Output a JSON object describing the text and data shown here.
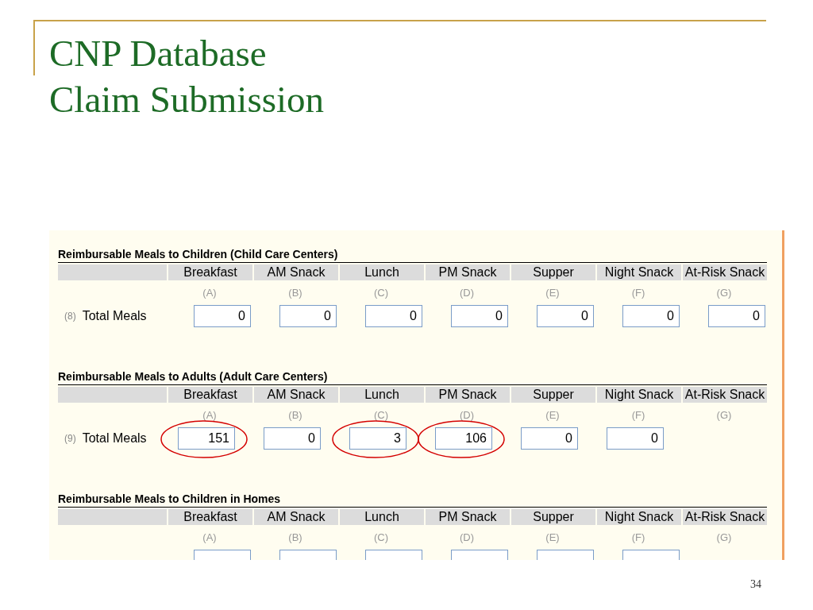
{
  "slide": {
    "title_lines": [
      "CNP Database",
      "Claim Submission"
    ],
    "page_number": "34"
  },
  "sections": [
    {
      "heading": "Reimbursable Meals to Children (Child Care Centers)",
      "columns": [
        "Breakfast",
        "AM Snack",
        "Lunch",
        "PM Snack",
        "Supper",
        "Night Snack",
        "At-Risk Snack"
      ],
      "letters": [
        "(A)",
        "(B)",
        "(C)",
        "(D)",
        "(E)",
        "(F)",
        "(G)"
      ],
      "row": {
        "number": "(8)",
        "label": "Total Meals",
        "fields": [
          {
            "value": "0",
            "circled": false
          },
          {
            "value": "0",
            "circled": false
          },
          {
            "value": "0",
            "circled": false
          },
          {
            "value": "0",
            "circled": false
          },
          {
            "value": "0",
            "circled": false
          },
          {
            "value": "0",
            "circled": false
          },
          {
            "value": "0",
            "circled": false
          }
        ]
      }
    },
    {
      "heading": "Reimbursable Meals to Adults (Adult Care Centers)",
      "columns": [
        "Breakfast",
        "AM Snack",
        "Lunch",
        "PM Snack",
        "Supper",
        "Night Snack",
        "At-Risk Snack"
      ],
      "letters": [
        "(A)",
        "(B)",
        "(C)",
        "(D)",
        "(E)",
        "(F)",
        "(G)"
      ],
      "row": {
        "number": "(9)",
        "label": "Total Meals",
        "fields": [
          {
            "value": "151",
            "circled": true
          },
          {
            "value": "0",
            "circled": false
          },
          {
            "value": "3",
            "circled": true
          },
          {
            "value": "106",
            "circled": true
          },
          {
            "value": "0",
            "circled": false
          },
          {
            "value": "0",
            "circled": false
          }
        ]
      }
    },
    {
      "heading": "Reimbursable Meals to Children in Homes",
      "columns": [
        "Breakfast",
        "AM Snack",
        "Lunch",
        "PM Snack",
        "Supper",
        "Night Snack",
        "At-Risk Snack"
      ],
      "letters": [
        "(A)",
        "(B)",
        "(C)",
        "(D)",
        "(E)",
        "(F)",
        "(G)"
      ],
      "row": {
        "fields": [
          {
            "circled": false
          },
          {
            "circled": false
          },
          {
            "circled": false
          },
          {
            "circled": false
          },
          {
            "circled": false
          },
          {
            "circled": false
          }
        ]
      }
    }
  ]
}
